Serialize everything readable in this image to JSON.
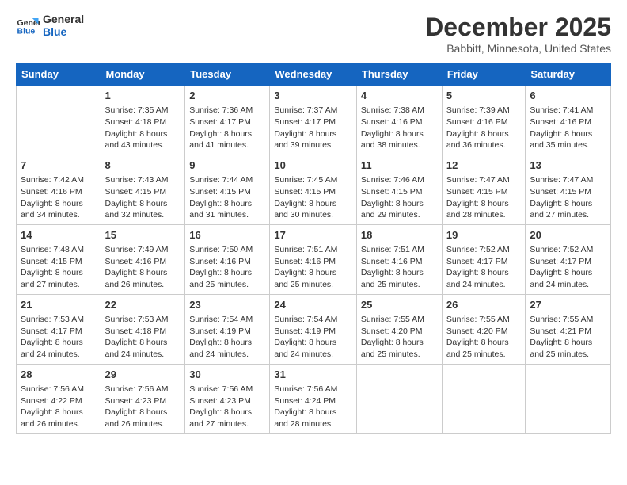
{
  "header": {
    "logo_line1": "General",
    "logo_line2": "Blue",
    "title": "December 2025",
    "subtitle": "Babbitt, Minnesota, United States"
  },
  "days_of_week": [
    "Sunday",
    "Monday",
    "Tuesday",
    "Wednesday",
    "Thursday",
    "Friday",
    "Saturday"
  ],
  "weeks": [
    [
      {
        "day": "",
        "info": ""
      },
      {
        "day": "1",
        "info": "Sunrise: 7:35 AM\nSunset: 4:18 PM\nDaylight: 8 hours\nand 43 minutes."
      },
      {
        "day": "2",
        "info": "Sunrise: 7:36 AM\nSunset: 4:17 PM\nDaylight: 8 hours\nand 41 minutes."
      },
      {
        "day": "3",
        "info": "Sunrise: 7:37 AM\nSunset: 4:17 PM\nDaylight: 8 hours\nand 39 minutes."
      },
      {
        "day": "4",
        "info": "Sunrise: 7:38 AM\nSunset: 4:16 PM\nDaylight: 8 hours\nand 38 minutes."
      },
      {
        "day": "5",
        "info": "Sunrise: 7:39 AM\nSunset: 4:16 PM\nDaylight: 8 hours\nand 36 minutes."
      },
      {
        "day": "6",
        "info": "Sunrise: 7:41 AM\nSunset: 4:16 PM\nDaylight: 8 hours\nand 35 minutes."
      }
    ],
    [
      {
        "day": "7",
        "info": "Sunrise: 7:42 AM\nSunset: 4:16 PM\nDaylight: 8 hours\nand 34 minutes."
      },
      {
        "day": "8",
        "info": "Sunrise: 7:43 AM\nSunset: 4:15 PM\nDaylight: 8 hours\nand 32 minutes."
      },
      {
        "day": "9",
        "info": "Sunrise: 7:44 AM\nSunset: 4:15 PM\nDaylight: 8 hours\nand 31 minutes."
      },
      {
        "day": "10",
        "info": "Sunrise: 7:45 AM\nSunset: 4:15 PM\nDaylight: 8 hours\nand 30 minutes."
      },
      {
        "day": "11",
        "info": "Sunrise: 7:46 AM\nSunset: 4:15 PM\nDaylight: 8 hours\nand 29 minutes."
      },
      {
        "day": "12",
        "info": "Sunrise: 7:47 AM\nSunset: 4:15 PM\nDaylight: 8 hours\nand 28 minutes."
      },
      {
        "day": "13",
        "info": "Sunrise: 7:47 AM\nSunset: 4:15 PM\nDaylight: 8 hours\nand 27 minutes."
      }
    ],
    [
      {
        "day": "14",
        "info": "Sunrise: 7:48 AM\nSunset: 4:15 PM\nDaylight: 8 hours\nand 27 minutes."
      },
      {
        "day": "15",
        "info": "Sunrise: 7:49 AM\nSunset: 4:16 PM\nDaylight: 8 hours\nand 26 minutes."
      },
      {
        "day": "16",
        "info": "Sunrise: 7:50 AM\nSunset: 4:16 PM\nDaylight: 8 hours\nand 25 minutes."
      },
      {
        "day": "17",
        "info": "Sunrise: 7:51 AM\nSunset: 4:16 PM\nDaylight: 8 hours\nand 25 minutes."
      },
      {
        "day": "18",
        "info": "Sunrise: 7:51 AM\nSunset: 4:16 PM\nDaylight: 8 hours\nand 25 minutes."
      },
      {
        "day": "19",
        "info": "Sunrise: 7:52 AM\nSunset: 4:17 PM\nDaylight: 8 hours\nand 24 minutes."
      },
      {
        "day": "20",
        "info": "Sunrise: 7:52 AM\nSunset: 4:17 PM\nDaylight: 8 hours\nand 24 minutes."
      }
    ],
    [
      {
        "day": "21",
        "info": "Sunrise: 7:53 AM\nSunset: 4:17 PM\nDaylight: 8 hours\nand 24 minutes."
      },
      {
        "day": "22",
        "info": "Sunrise: 7:53 AM\nSunset: 4:18 PM\nDaylight: 8 hours\nand 24 minutes."
      },
      {
        "day": "23",
        "info": "Sunrise: 7:54 AM\nSunset: 4:19 PM\nDaylight: 8 hours\nand 24 minutes."
      },
      {
        "day": "24",
        "info": "Sunrise: 7:54 AM\nSunset: 4:19 PM\nDaylight: 8 hours\nand 24 minutes."
      },
      {
        "day": "25",
        "info": "Sunrise: 7:55 AM\nSunset: 4:20 PM\nDaylight: 8 hours\nand 25 minutes."
      },
      {
        "day": "26",
        "info": "Sunrise: 7:55 AM\nSunset: 4:20 PM\nDaylight: 8 hours\nand 25 minutes."
      },
      {
        "day": "27",
        "info": "Sunrise: 7:55 AM\nSunset: 4:21 PM\nDaylight: 8 hours\nand 25 minutes."
      }
    ],
    [
      {
        "day": "28",
        "info": "Sunrise: 7:56 AM\nSunset: 4:22 PM\nDaylight: 8 hours\nand 26 minutes."
      },
      {
        "day": "29",
        "info": "Sunrise: 7:56 AM\nSunset: 4:23 PM\nDaylight: 8 hours\nand 26 minutes."
      },
      {
        "day": "30",
        "info": "Sunrise: 7:56 AM\nSunset: 4:23 PM\nDaylight: 8 hours\nand 27 minutes."
      },
      {
        "day": "31",
        "info": "Sunrise: 7:56 AM\nSunset: 4:24 PM\nDaylight: 8 hours\nand 28 minutes."
      },
      {
        "day": "",
        "info": ""
      },
      {
        "day": "",
        "info": ""
      },
      {
        "day": "",
        "info": ""
      }
    ]
  ]
}
